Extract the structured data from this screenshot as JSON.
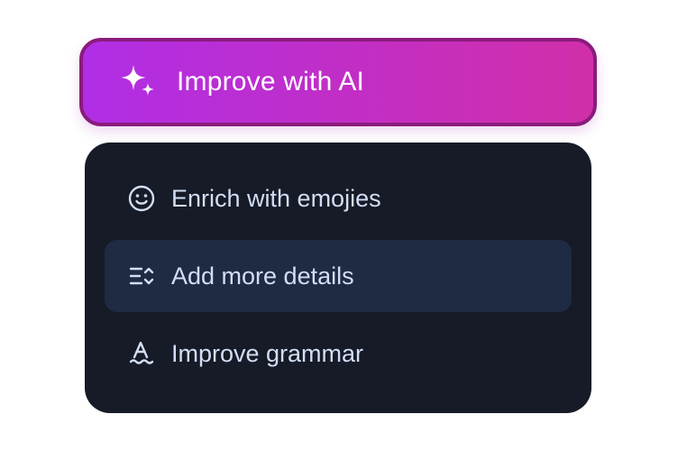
{
  "colors": {
    "button_gradient_start": "#b02ee6",
    "button_gradient_end": "#d12fa8",
    "button_border": "#8a1b7c",
    "menu_background": "#161b27",
    "menu_active_background": "#1f2a43",
    "menu_text": "#d3def5"
  },
  "ai_button": {
    "icon": "sparkles-icon",
    "label": "Improve with AI"
  },
  "menu": {
    "items": [
      {
        "icon": "smiley-face-icon",
        "label": "Enrich with emojies",
        "active": false
      },
      {
        "icon": "expand-text-icon",
        "label": "Add more details",
        "active": true
      },
      {
        "icon": "spellcheck-icon",
        "label": "Improve grammar",
        "active": false
      }
    ]
  }
}
